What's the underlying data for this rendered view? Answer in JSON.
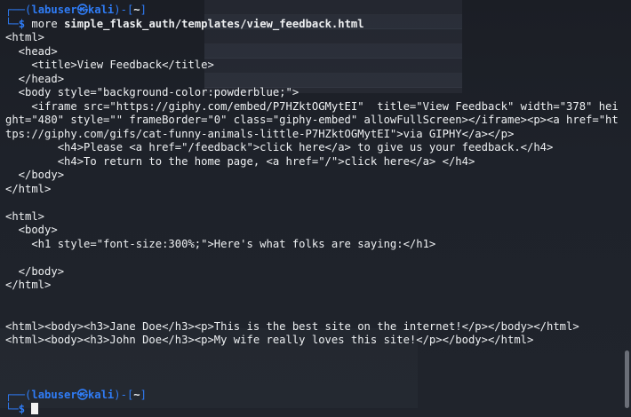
{
  "prompt": {
    "user_host": "labuser㉿kali",
    "dir": "~",
    "symbol": "$"
  },
  "command": {
    "name": "more",
    "arg": "simple_flask_auth/templates/view_feedback.html"
  },
  "output": [
    "<html>",
    "  <head>",
    "    <title>View Feedback</title>",
    "  </head>",
    "  <body style=\"background-color:powderblue;\">",
    "    <iframe src=\"https://giphy.com/embed/P7HZktOGMytEI\"  title=\"View Feedback\" width=\"378\" height=\"480\" style=\"\" frameBorder=\"0\" class=\"giphy-embed\" allowFullScreen></iframe><p><a href=\"https://giphy.com/gifs/cat-funny-animals-little-P7HZktOGMytEI\">via GIPHY</a></p>",
    "        <h4>Please <a href=\"/feedback\">click here</a> to give us your feedback.</h4>",
    "        <h4>To return to the home page, <a href=\"/\">click here</a> </h4>",
    "  </body>",
    "</html>",
    "",
    "<html>",
    "  <body>",
    "    <h1 style=\"font-size:300%;\">Here's what folks are saying:</h1>",
    "",
    "  </body>",
    "</html>",
    "",
    "",
    "<html><body><h3>Jane Doe</h3><p>This is the best site on the internet!</p></body></html>",
    "<html><body><h3>John Doe</h3><p>My wife really loves this site!</p></body></html>",
    "",
    "",
    ""
  ],
  "colors": {
    "background": "#1c1f26",
    "prompt_blue": "#2f7cf6",
    "text": "#eef0f2"
  }
}
